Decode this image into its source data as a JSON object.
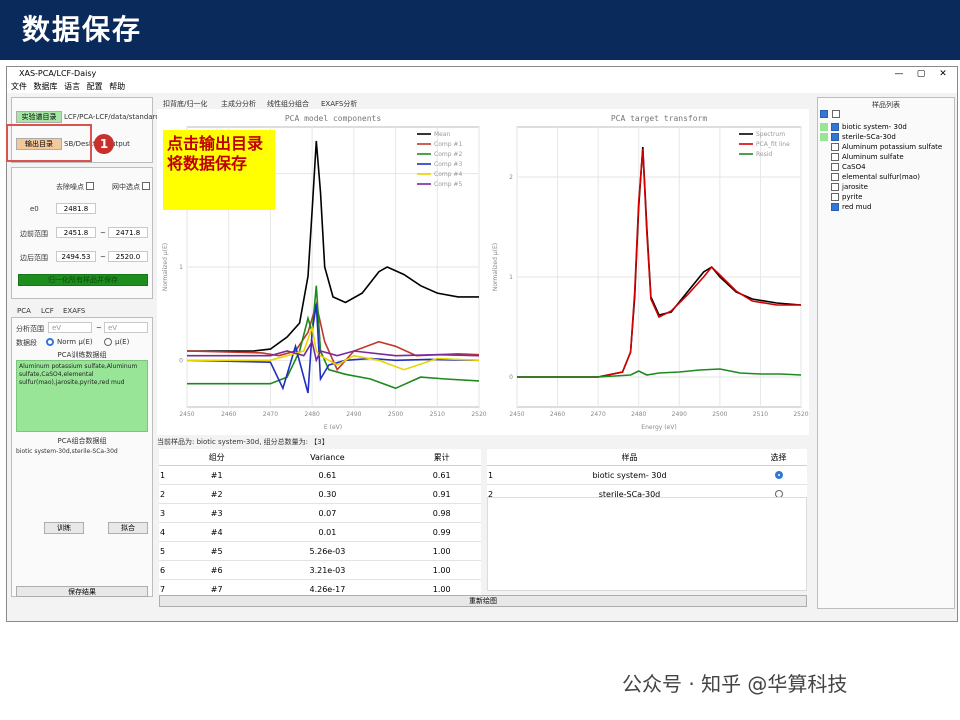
{
  "slide": {
    "title": "数据保存"
  },
  "window": {
    "title": "XAS-PCA/LCF-Daisy",
    "controls": [
      "—",
      "▢",
      "✕"
    ]
  },
  "menu": [
    "文件",
    "数据库",
    "语言",
    "配置",
    "帮助"
  ],
  "left": {
    "exp_dir_btn": "实验谱目录",
    "exp_dir_path": "LCF/PCA-LCF/data/standard",
    "out_dir_btn": "输出目录",
    "out_dir_path": "SB/Desktop/output",
    "remove_noise": "去除噪点",
    "grid_select": "网中选点",
    "e0_label": "e0",
    "e0_value": "2481.8",
    "edge_range_label": "边前范围",
    "edge_from": "2451.8",
    "edge_to": "2471.8",
    "post_range_label": "边后范围",
    "post_from": "2494.53",
    "post_to": "2520.0",
    "green_btn": "归一化所有样品并保存",
    "tabs": [
      "PCA",
      "LCF",
      "EXAFS"
    ],
    "analysis_range": "分析范围",
    "range_hint_a": "eV",
    "range_hint_b": "eV",
    "dataset_label": "数据段",
    "norm_option": "Norm μ(E)",
    "mu_option": "μ(E)",
    "pca_train_label": "PCA训练数据组",
    "pca_train_text": "Aluminum potassium sulfate,Aluminum sulfate,CaSO4,elemental sulfur(mao),jarosite,pyrite,red mud",
    "pca_combo_label": "PCA组合数据组",
    "pca_combo_text": "biotic system-30d,sterile-SCa-30d",
    "train_btn": "训练",
    "fit_btn": "拟合",
    "save_btn": "保存结果"
  },
  "tabs": [
    "扣背底/归一化",
    "主成分分析",
    "线性组分组合",
    "EXAFS分析"
  ],
  "status_text": "当前样品为: biotic system-30d, 组分总数量为: 【3】",
  "refresh_btn": "重新绘图",
  "components_table": {
    "headers": [
      "组分",
      "Variance",
      "累计"
    ],
    "rows": [
      [
        "1",
        "#1",
        "0.61",
        "0.61"
      ],
      [
        "2",
        "#2",
        "0.30",
        "0.91"
      ],
      [
        "3",
        "#3",
        "0.07",
        "0.98"
      ],
      [
        "4",
        "#4",
        "0.01",
        "0.99"
      ],
      [
        "5",
        "#5",
        "5.26e-03",
        "1.00"
      ],
      [
        "6",
        "#6",
        "3.21e-03",
        "1.00"
      ],
      [
        "7",
        "#7",
        "4.26e-17",
        "1.00"
      ]
    ]
  },
  "sample_table": {
    "headers": [
      "样品",
      "选择"
    ],
    "rows": [
      {
        "idx": "1",
        "name": "biotic system- 30d",
        "selected": true
      },
      {
        "idx": "2",
        "name": "sterile-SCa-30d",
        "selected": false
      }
    ]
  },
  "sample_list": {
    "title": "样品列表",
    "items": [
      {
        "name": "biotic system- 30d",
        "checked": true,
        "highlight": true
      },
      {
        "name": "sterile-SCa-30d",
        "checked": true,
        "highlight": true
      },
      {
        "name": "Aluminum potassium sulfate",
        "checked": false,
        "highlight": false
      },
      {
        "name": "Aluminum sulfate",
        "checked": false,
        "highlight": false
      },
      {
        "name": "CaSO4",
        "checked": false,
        "highlight": false
      },
      {
        "name": "elemental sulfur(mao)",
        "checked": false,
        "highlight": false
      },
      {
        "name": "jarosite",
        "checked": false,
        "highlight": false
      },
      {
        "name": "pyrite",
        "checked": false,
        "highlight": false
      },
      {
        "name": "red mud",
        "checked": true,
        "highlight": false
      }
    ]
  },
  "annotation": {
    "number": "1",
    "note": "点击输出目录将数据保存"
  },
  "watermark": "公众号 · 知乎 @华算科技",
  "colors": {
    "header_bg": "#0b2a5c",
    "accent_green": "#98e598",
    "annotation_red": "#d9534f",
    "note_yellow": "#ffff00"
  },
  "chart_data": [
    {
      "type": "line",
      "title": "PCA model components",
      "xlabel": "E (eV)",
      "ylabel": "Normalized μ(E)",
      "xlim": [
        2450,
        2520
      ],
      "ylim": [
        -0.5,
        2.5
      ],
      "x_ticks": [
        "2450",
        "2460",
        "2470",
        "2480",
        "2490",
        "2500",
        "2510",
        "2520"
      ],
      "y_ticks": [
        "0",
        "1",
        "2"
      ],
      "grid": true,
      "legend_position": "top-right",
      "series": [
        {
          "name": "Mean",
          "color": "#000000",
          "x": [
            2450,
            2466,
            2470,
            2474,
            2477,
            2479,
            2480,
            2481,
            2482,
            2483,
            2485,
            2488,
            2492,
            2496,
            2498,
            2502,
            2506,
            2510,
            2515,
            2520
          ],
          "y": [
            0.1,
            0.1,
            0.12,
            0.25,
            0.4,
            0.9,
            1.6,
            2.35,
            1.8,
            1.0,
            0.68,
            0.62,
            0.72,
            0.95,
            1.0,
            0.92,
            0.8,
            0.72,
            0.68,
            0.68
          ]
        },
        {
          "name": "Comp #1",
          "color": "#c0392b",
          "x": [
            2450,
            2468,
            2472,
            2476,
            2479,
            2481,
            2483,
            2486,
            2490,
            2496,
            2500,
            2505,
            2510,
            2515,
            2520
          ],
          "y": [
            0.1,
            0.08,
            0.05,
            0.1,
            0.3,
            0.6,
            0.2,
            -0.1,
            0.1,
            0.2,
            0.15,
            0.05,
            0.06,
            0.07,
            0.06
          ]
        },
        {
          "name": "Comp #2",
          "color": "#1e8a1e",
          "x": [
            2450,
            2470,
            2474,
            2477,
            2479,
            2480,
            2481,
            2482,
            2484,
            2488,
            2494,
            2500,
            2506,
            2512,
            2520
          ],
          "y": [
            -0.25,
            -0.25,
            -0.18,
            0.1,
            0.45,
            0.3,
            0.8,
            0.1,
            -0.1,
            -0.15,
            -0.2,
            -0.3,
            -0.18,
            -0.2,
            -0.22
          ]
        },
        {
          "name": "Comp #3",
          "color": "#1f2fbf",
          "x": [
            2450,
            2470,
            2473,
            2476,
            2479,
            2480,
            2481,
            2482,
            2484,
            2488,
            2494,
            2500,
            2508,
            2520
          ],
          "y": [
            0.0,
            -0.02,
            -0.3,
            0.15,
            -0.35,
            0.3,
            0.6,
            -0.2,
            -0.05,
            0.0,
            0.02,
            0.0,
            0.01,
            0.0
          ]
        },
        {
          "name": "Comp #4",
          "color": "#e6d400",
          "x": [
            2450,
            2470,
            2474,
            2478,
            2480,
            2481,
            2482,
            2486,
            2490,
            2496,
            2502,
            2510,
            2520
          ],
          "y": [
            0.0,
            0.0,
            0.05,
            0.1,
            0.35,
            0.1,
            0.05,
            -0.05,
            0.05,
            0.0,
            -0.1,
            0.02,
            0.0
          ]
        },
        {
          "name": "Comp #5",
          "color": "#7a2a9a",
          "x": [
            2450,
            2470,
            2474,
            2478,
            2480,
            2481,
            2482,
            2486,
            2490,
            2500,
            2510,
            2520
          ],
          "y": [
            0.05,
            0.05,
            0.1,
            0.05,
            0.2,
            0.0,
            0.1,
            0.05,
            0.1,
            0.05,
            0.06,
            0.05
          ]
        }
      ]
    },
    {
      "type": "line",
      "title": "PCA target transform",
      "xlabel": "Energy (eV)",
      "ylabel": "Normalized μ(E)",
      "xlim": [
        2450,
        2520
      ],
      "ylim": [
        -0.3,
        2.5
      ],
      "x_ticks": [
        "2450",
        "2460",
        "2470",
        "2480",
        "2490",
        "2500",
        "2510",
        "2520"
      ],
      "y_ticks": [
        "0",
        "1",
        "2"
      ],
      "grid": true,
      "legend_position": "top-right",
      "series": [
        {
          "name": "Spectrum",
          "color": "#000000",
          "x": [
            2450,
            2470,
            2476,
            2478,
            2479,
            2480,
            2481,
            2482,
            2483,
            2485,
            2488,
            2492,
            2496,
            2498,
            2500,
            2504,
            2508,
            2514,
            2520
          ],
          "y": [
            0.0,
            0.0,
            0.05,
            0.25,
            0.8,
            1.7,
            2.3,
            1.5,
            0.8,
            0.62,
            0.65,
            0.85,
            1.05,
            1.1,
            1.0,
            0.85,
            0.78,
            0.74,
            0.72
          ]
        },
        {
          "name": "PCA_fit line",
          "color": "#d40000",
          "x": [
            2450,
            2470,
            2476,
            2478,
            2479,
            2480,
            2481,
            2482,
            2483,
            2485,
            2488,
            2492,
            2496,
            2498,
            2500,
            2504,
            2508,
            2514,
            2520
          ],
          "y": [
            0.0,
            0.0,
            0.05,
            0.25,
            0.85,
            1.75,
            2.28,
            1.45,
            0.78,
            0.6,
            0.66,
            0.82,
            1.0,
            1.1,
            1.02,
            0.86,
            0.76,
            0.72,
            0.72
          ]
        },
        {
          "name": "Resid",
          "color": "#1e8a1e",
          "x": [
            2450,
            2470,
            2478,
            2480,
            2482,
            2485,
            2490,
            2495,
            2500,
            2505,
            2510,
            2515,
            2520
          ],
          "y": [
            0.0,
            0.0,
            0.02,
            0.06,
            0.02,
            0.04,
            0.05,
            0.07,
            0.08,
            0.04,
            0.03,
            0.03,
            0.02
          ]
        }
      ]
    }
  ]
}
